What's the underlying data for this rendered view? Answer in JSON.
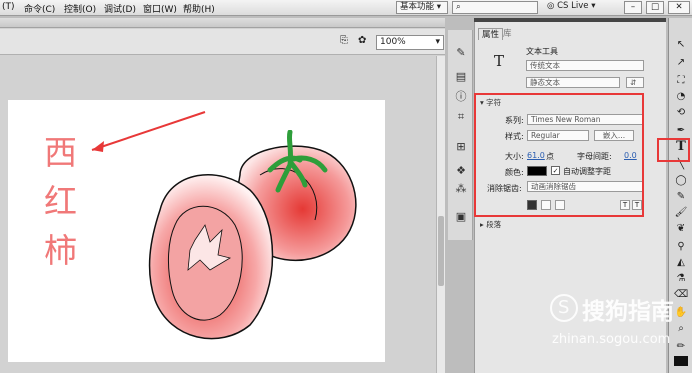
{
  "menu": {
    "items": [
      "(T)",
      "命令(C)",
      "控制(O)",
      "调试(D)",
      "窗口(W)",
      "帮助(H)"
    ]
  },
  "workspace": {
    "label": "基本功能",
    "search_placeholder": "",
    "cs_live": "CS Live"
  },
  "stage": {
    "zoom": "100%"
  },
  "canvas_text": {
    "chars": [
      "西",
      "红",
      "柿"
    ]
  },
  "panel": {
    "tabs": [
      "属性",
      "库"
    ],
    "tool_name": "文本工具",
    "text_kind": "传统文本",
    "text_type": "静态文本",
    "section_char": "字符",
    "family_label": "系列:",
    "family_value": "Times New Roman",
    "style_label": "样式:",
    "style_value": "Regular",
    "embed_button": "嵌入...",
    "size_label": "大小:",
    "size_value": "61.0",
    "size_unit": "点",
    "spacing_label": "字母间距:",
    "spacing_value": "0.0",
    "color_label": "颜色:",
    "auto_kern": "自动调整字距",
    "aa_label": "消除锯齿:",
    "aa_value": "动画消除锯齿",
    "section_para": "段落"
  },
  "watermark": {
    "brand": "搜狗指南",
    "url": "zhinan.sogou.com"
  },
  "colors": {
    "red_annotation": "#e83838",
    "tomato_red": "#e53935",
    "leaf_green": "#2e9e3a"
  }
}
